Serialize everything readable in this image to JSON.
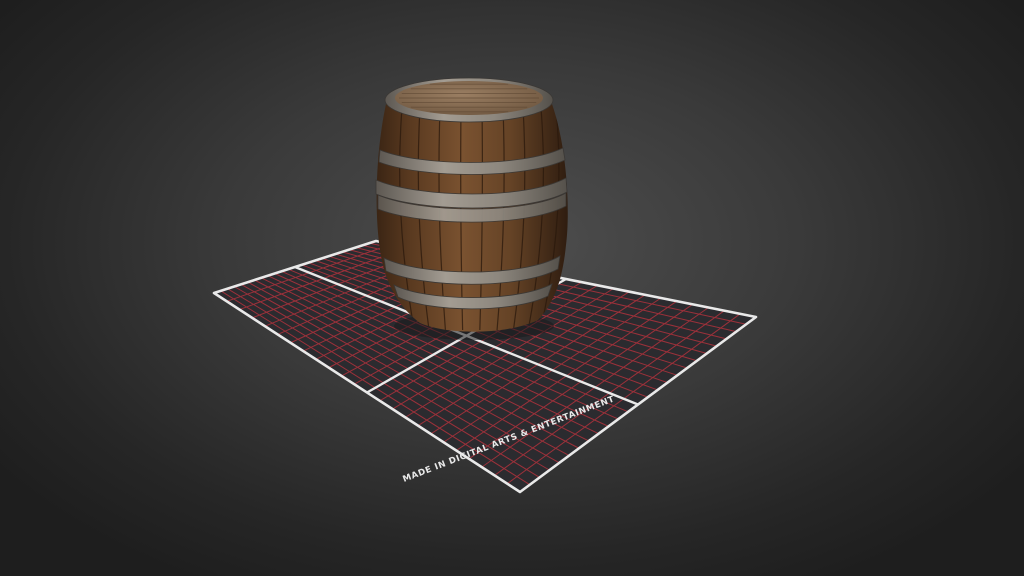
{
  "scene": {
    "object": "wooden barrel",
    "ground_label": "MADE IN DIGITAL ARTS & ENTERTAINMENT"
  },
  "colors": {
    "grid_line": "#a8323c",
    "grid_border": "#e9e9e9",
    "grid_fill": "#2b2b2f",
    "wood": "#6b4727",
    "wood_dark": "#3c2614",
    "hoop": "#8b857d",
    "lid": "#8a6f55"
  }
}
